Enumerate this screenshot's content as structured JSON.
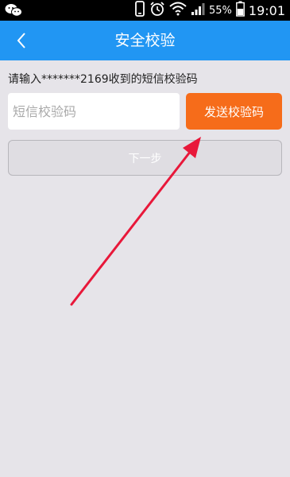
{
  "status_bar": {
    "battery_percent": "55%",
    "time": "19:01",
    "icons": [
      "wechat-icon",
      "phone-icon",
      "alarm-icon",
      "wifi-icon",
      "signal-icon",
      "battery-icon"
    ]
  },
  "header": {
    "title": "安全校验",
    "back_icon": "chevron-left-icon"
  },
  "prompt": "请输入*******2169收到的短信校验码",
  "sms_input": {
    "placeholder": "短信校验码",
    "value": ""
  },
  "send_code_label": "发送校验码",
  "next_label": "下一步",
  "colors": {
    "header": "#2196f3",
    "accent": "#f66c1a",
    "background": "#e6e4e9",
    "annotation": "#e8183a"
  }
}
